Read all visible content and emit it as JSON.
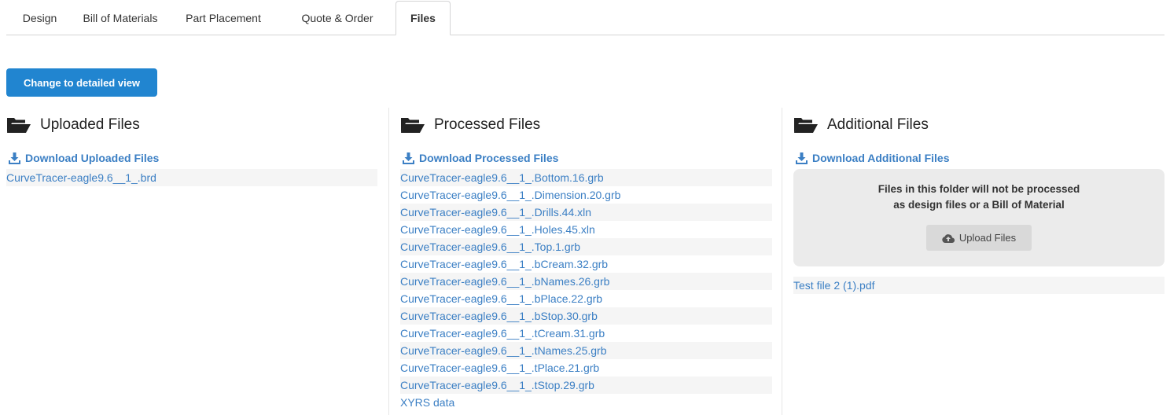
{
  "tabs": [
    {
      "label": "Design"
    },
    {
      "label": "Bill of Materials"
    },
    {
      "label": "Part Placement"
    },
    {
      "label": "Quote & Order"
    },
    {
      "label": "Files",
      "active": true
    }
  ],
  "view_button": {
    "label": "Change to detailed view"
  },
  "uploaded": {
    "title": "Uploaded Files",
    "download_label": "Download Uploaded Files",
    "files": [
      "CurveTracer-eagle9.6__1_.brd"
    ]
  },
  "processed": {
    "title": "Processed Files",
    "download_label": "Download Processed Files",
    "files": [
      "CurveTracer-eagle9.6__1_.Bottom.16.grb",
      "CurveTracer-eagle9.6__1_.Dimension.20.grb",
      "CurveTracer-eagle9.6__1_.Drills.44.xln",
      "CurveTracer-eagle9.6__1_.Holes.45.xln",
      "CurveTracer-eagle9.6__1_.Top.1.grb",
      "CurveTracer-eagle9.6__1_.bCream.32.grb",
      "CurveTracer-eagle9.6__1_.bNames.26.grb",
      "CurveTracer-eagle9.6__1_.bPlace.22.grb",
      "CurveTracer-eagle9.6__1_.bStop.30.grb",
      "CurveTracer-eagle9.6__1_.tCream.31.grb",
      "CurveTracer-eagle9.6__1_.tNames.25.grb",
      "CurveTracer-eagle9.6__1_.tPlace.21.grb",
      "CurveTracer-eagle9.6__1_.tStop.29.grb",
      "XYRS data"
    ]
  },
  "additional": {
    "title": "Additional Files",
    "download_label": "Download Additional Files",
    "info_line1": "Files in this folder will not be processed",
    "info_line2": "as design files or a Bill of Material",
    "upload_label": "Upload Files",
    "files": [
      "Test file 2 (1).pdf"
    ]
  },
  "colors": {
    "accent": "#2185d0",
    "link": "#3b7fc4",
    "stripe": "#f5f5f5",
    "info_bg": "#ebebeb"
  },
  "icons": {
    "folder": "folder-open-icon",
    "download": "download-icon",
    "upload": "cloud-upload-icon"
  }
}
